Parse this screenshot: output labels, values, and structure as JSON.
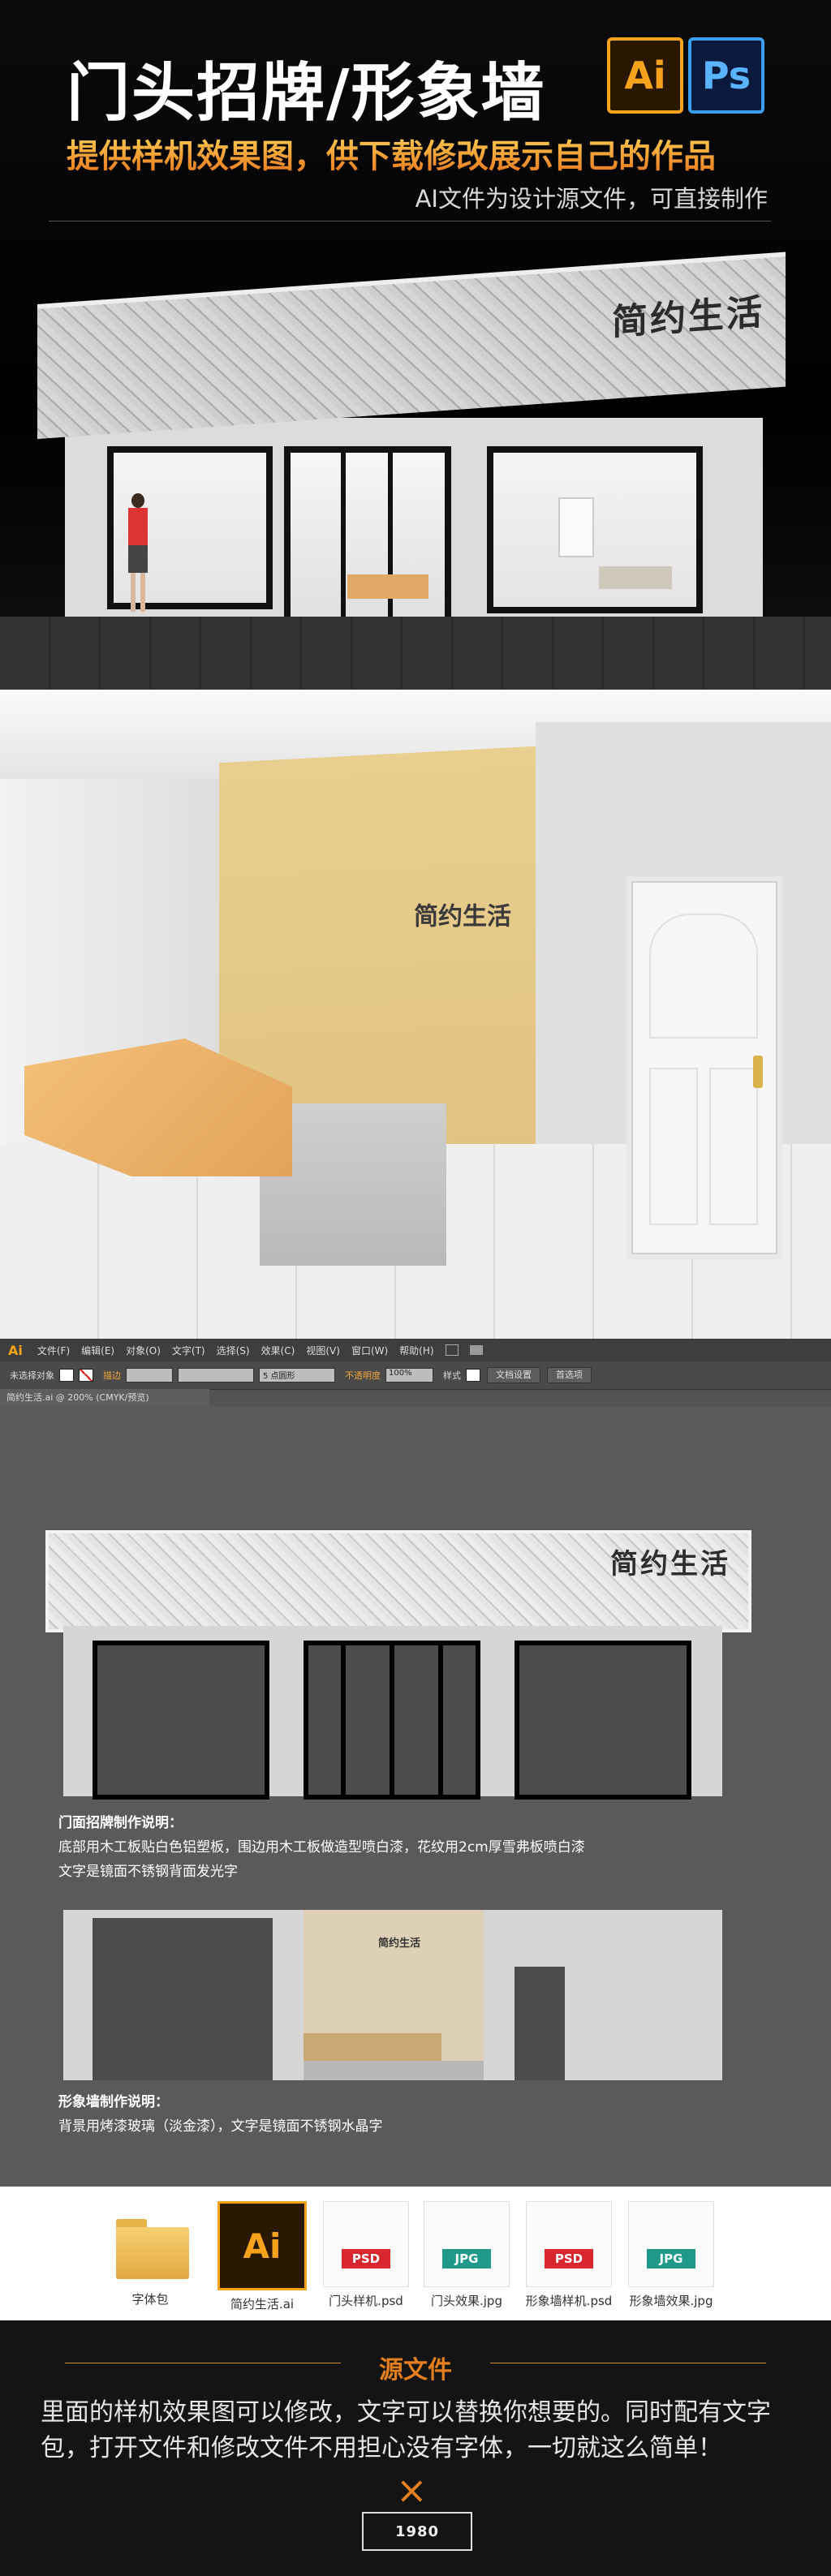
{
  "hero": {
    "title": "门头招牌/形象墙",
    "subtitle": "提供样机效果图，供下载修改展示自己的作品",
    "note": "AI文件为设计源文件，可直接制作",
    "ai_badge": "Ai",
    "ps_badge": "Ps",
    "sign_text": "简约生活"
  },
  "lobby": {
    "logo_text": "简约生活"
  },
  "app": {
    "logo": "Ai",
    "menu": [
      "文件(F)",
      "编辑(E)",
      "对象(O)",
      "文字(T)",
      "选择(S)",
      "效果(C)",
      "视图(V)",
      "窗口(W)",
      "帮助(H)"
    ],
    "control": {
      "selection": "未选择对象",
      "stroke_label": "描边",
      "brush": "5 点圆形",
      "opacity_label": "不透明度",
      "opacity_value": "100%",
      "style_label": "样式",
      "doc_setup": "文档设置",
      "prefs": "首选项"
    },
    "doc_tab": "简约生活.ai @ 200% (CMYK/预览)",
    "artboard": {
      "sign_text": "简约生活",
      "front_heading": "门面招牌制作说明：",
      "front_desc_1": "底部用木工板贴白色铝塑板，围边用木工板做造型喷白漆，花纹用2cm厚雪弗板喷白漆",
      "front_desc_2": "文字是镜面不锈钢背面发光字",
      "wall_sign_text": "简约生活",
      "wall_heading": "形象墙制作说明：",
      "wall_desc": "背景用烤漆玻璃（淡金漆），文字是镜面不锈钢水晶字"
    }
  },
  "files": [
    {
      "label": "字体包",
      "type": "folder"
    },
    {
      "label": "简约生活.ai",
      "type": "ai",
      "tag": "Ai"
    },
    {
      "label": "门头样机.psd",
      "type": "psd",
      "tag": "PSD"
    },
    {
      "label": "门头效果.jpg",
      "type": "jpg",
      "tag": "JPG"
    },
    {
      "label": "形象墙样机.psd",
      "type": "psd",
      "tag": "PSD"
    },
    {
      "label": "形象墙效果.jpg",
      "type": "jpg",
      "tag": "JPG"
    }
  ],
  "footer": {
    "heading": "源文件",
    "body": "里面的样机效果图可以修改，文字可以替换你想要的。同时配有文字包，打开文件和修改文件不用担心没有字体，一切就这么简单！",
    "mark": "×",
    "brand": "1980"
  },
  "colors": {
    "accent_orange": "#e37f1e",
    "ai_orange": "#f7a21b",
    "ps_blue": "#3a9ef1",
    "gold_wall": "#e3c585"
  }
}
